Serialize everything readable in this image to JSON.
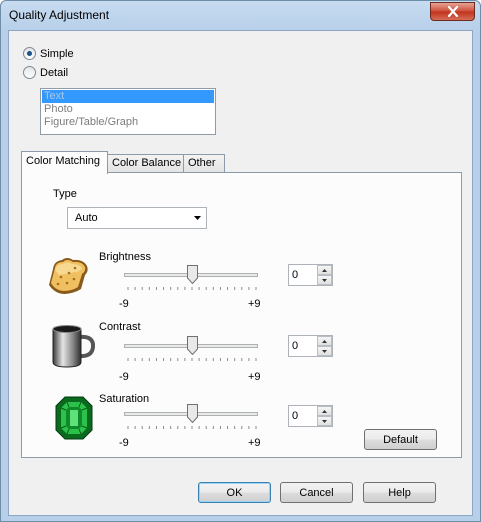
{
  "window": {
    "title": "Quality Adjustment"
  },
  "mode": {
    "simple_label": "Simple",
    "detail_label": "Detail",
    "selected": "Simple"
  },
  "target_list": {
    "items": [
      "Text",
      "Photo",
      "Figure/Table/Graph"
    ],
    "selected_index": 0
  },
  "tabs": [
    {
      "label": "Color Matching",
      "active": true
    },
    {
      "label": "Color Balance",
      "active": false
    },
    {
      "label": "Other",
      "active": false
    }
  ],
  "color_matching": {
    "type_label": "Type",
    "type_value": "Auto",
    "sliders": [
      {
        "label": "Brightness",
        "icon": "toast-icon",
        "value": "0",
        "min_label": "-9",
        "max_label": "+9"
      },
      {
        "label": "Contrast",
        "icon": "mug-icon",
        "value": "0",
        "min_label": "-9",
        "max_label": "+9"
      },
      {
        "label": "Saturation",
        "icon": "emerald-icon",
        "value": "0",
        "min_label": "-9",
        "max_label": "+9"
      }
    ],
    "default_button": "Default"
  },
  "footer": {
    "ok": "OK",
    "cancel": "Cancel",
    "help": "Help"
  },
  "colors": {
    "selection": "#3399ff",
    "title_bar": "#b7cfe9",
    "close_button": "#c0321c"
  }
}
